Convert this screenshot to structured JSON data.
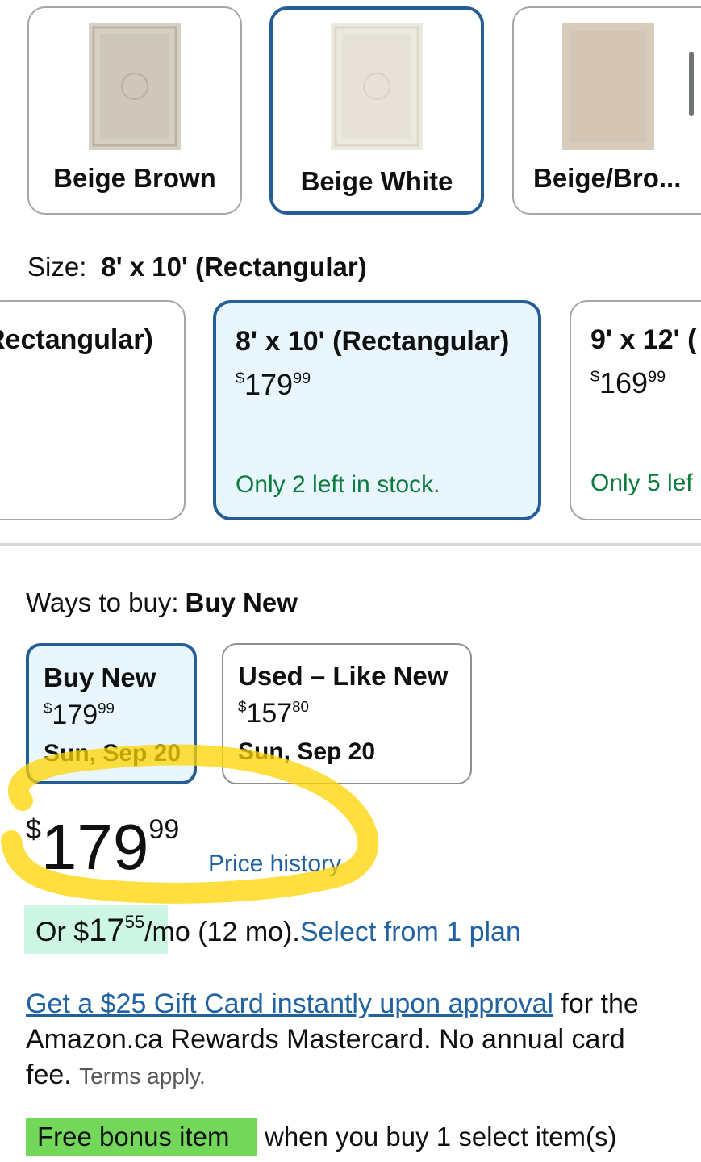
{
  "colors_selector": {
    "options": [
      {
        "label": "Beige Brown",
        "selected": false
      },
      {
        "label": "Beige White",
        "selected": true
      },
      {
        "label": "Beige/Bro...",
        "selected": false
      }
    ]
  },
  "size_selector": {
    "prefix": "Size:",
    "selected_value": "8' x 10' (Rectangular)",
    "options": [
      {
        "title": "Rectangular)",
        "selected": false
      },
      {
        "title": "8' x 10' (Rectangular)",
        "currency": "$",
        "price_whole": "179",
        "price_cents": "99",
        "stock": "Only 2 left in stock.",
        "selected": true
      },
      {
        "title": "9' x 12' (",
        "currency": "$",
        "price_whole": "169",
        "price_cents": "99",
        "stock": "Only 5 lef",
        "selected": false
      }
    ]
  },
  "ways_to_buy": {
    "prefix": "Ways to buy:",
    "selected": "Buy New",
    "options": [
      {
        "title": "Buy New",
        "currency": "$",
        "price_whole": "179",
        "price_cents": "99",
        "date": "Sun, Sep 20",
        "selected": true
      },
      {
        "title": "Used – Like New",
        "currency": "$",
        "price_whole": "157",
        "price_cents": "80",
        "date": "Sun, Sep 20",
        "selected": false
      }
    ]
  },
  "price": {
    "currency": "$",
    "whole": "179",
    "cents": "99",
    "history_link": "Price history"
  },
  "monthly": {
    "prefix": "Or $",
    "whole": "17",
    "cents": "55",
    "suffix": "/mo (12 mo).",
    "link": "Select from 1 plan"
  },
  "gift_card": {
    "link": "Get a $25 Gift Card instantly upon approval",
    "text": " for the Amazon.ca Rewards Mastercard. No annual card fee. ",
    "terms": "Terms apply."
  },
  "bonus": {
    "badge": "Free bonus item",
    "text": "when you buy 1 select item(s)"
  },
  "theme": {
    "selected_border": "#255e96",
    "selected_bg": "#eaf6fd",
    "link": "#2162a1",
    "stock_green": "#0b7b3e",
    "highlighter_yellow": "#ffd400"
  }
}
